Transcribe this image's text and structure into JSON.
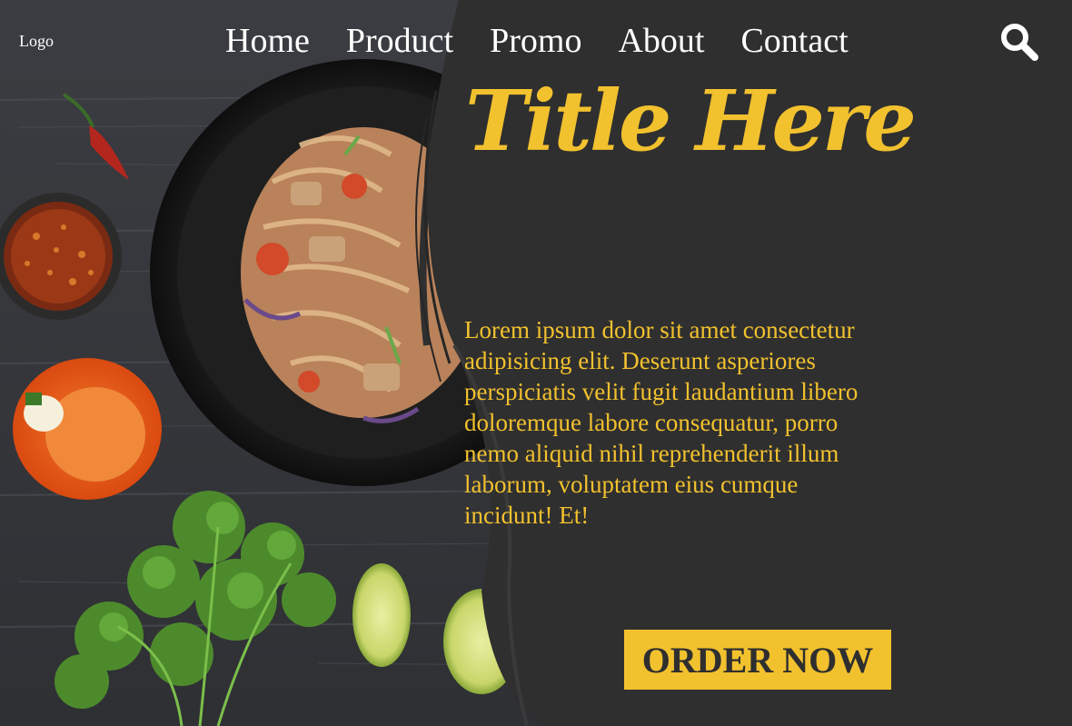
{
  "header": {
    "logo_text": "Logo",
    "nav": [
      {
        "label": "Home"
      },
      {
        "label": "Product"
      },
      {
        "label": "Promo"
      },
      {
        "label": "About"
      },
      {
        "label": "Contact"
      }
    ],
    "search_icon": "search-icon"
  },
  "hero": {
    "title": "Title Here",
    "description": "Lorem ipsum dolor sit amet consectetur adipisicing elit. Deserunt asperiores perspiciatis velit fugit laudantium libero doloremque labore consequatur, porro nemo aliquid nihil reprehenderit illum laborum, voluptatem eius cumque incidunt! Et!",
    "cta_label": "ORDER NOW"
  },
  "colors": {
    "background": "#2f2f2f",
    "accent": "#f2c12e",
    "text_light": "#ffffff"
  }
}
